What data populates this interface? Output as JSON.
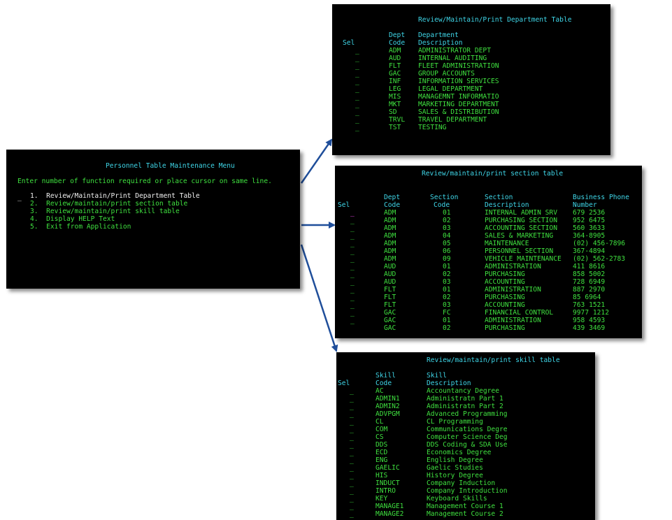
{
  "menu": {
    "title": "Personnel Table Maintenance Menu",
    "instruction": "Enter number of function required or place cursor on same line.",
    "cursor": "_",
    "items": [
      {
        "num": "1.",
        "label": "Review/Maintain/Print Department Table"
      },
      {
        "num": "2.",
        "label": "Review/maintain/print section table"
      },
      {
        "num": "3.",
        "label": "Review/maintain/print skill table"
      },
      {
        "num": "4.",
        "label": "Display HELP Text"
      },
      {
        "num": "5.",
        "label": "Exit from Application"
      }
    ]
  },
  "dept": {
    "title": "Review/Maintain/Print Department Table",
    "headers": {
      "sel": "Sel",
      "code1": "Dept",
      "code2": "Code",
      "desc1": "Department",
      "desc2": "Description"
    },
    "rows": [
      {
        "sel": "_",
        "code": "ADM",
        "desc": "ADMINISTRATOR DEPT"
      },
      {
        "sel": "_",
        "code": "AUD",
        "desc": "INTERNAL AUDITING"
      },
      {
        "sel": "_",
        "code": "FLT",
        "desc": "FLEET ADMINISTRATION"
      },
      {
        "sel": "_",
        "code": "GAC",
        "desc": "GROUP ACCOUNTS"
      },
      {
        "sel": "_",
        "code": "INF",
        "desc": "INFORMATION SERVICES"
      },
      {
        "sel": "_",
        "code": "LEG",
        "desc": "LEGAL DEPARTMENT"
      },
      {
        "sel": "_",
        "code": "MIS",
        "desc": "MANAGEMNT INFORMATIO"
      },
      {
        "sel": "_",
        "code": "MKT",
        "desc": "MARKETING DEPARTMENT"
      },
      {
        "sel": "_",
        "code": "SD",
        "desc": "SALES & DISTRIBUTION"
      },
      {
        "sel": "_",
        "code": "TRVL",
        "desc": "TRAVEL DEPARTMENT"
      },
      {
        "sel": "_",
        "code": "TST",
        "desc": "TESTING"
      }
    ]
  },
  "section": {
    "title": "Review/maintain/print section table",
    "headers": {
      "sel": "Sel",
      "dept1": "Dept",
      "dept2": "Code",
      "sec1": "Section",
      "sec2": "Code",
      "desc1": "Section",
      "desc2": "Description",
      "phone1": "Business Phone",
      "phone2": "Number"
    },
    "rows": [
      {
        "sel": "_",
        "dept": "ADM",
        "sec": "01",
        "desc": "INTERNAL ADMIN SRV",
        "phone": "679 2536"
      },
      {
        "sel": "_",
        "dept": "ADM",
        "sec": "02",
        "desc": "PURCHASING SECTION",
        "phone": "952 6475"
      },
      {
        "sel": "_",
        "dept": "ADM",
        "sec": "03",
        "desc": "ACCOUNTING SECTION",
        "phone": "560 3633"
      },
      {
        "sel": "_",
        "dept": "ADM",
        "sec": "04",
        "desc": "SALES & MARKETING",
        "phone": "364-8905"
      },
      {
        "sel": "_",
        "dept": "ADM",
        "sec": "05",
        "desc": "MAINTENANCE",
        "phone": "(02) 456-7896"
      },
      {
        "sel": "_",
        "dept": "ADM",
        "sec": "06",
        "desc": "PERSONNEL SECTION",
        "phone": "367-4894"
      },
      {
        "sel": "_",
        "dept": "ADM",
        "sec": "09",
        "desc": "VEHICLE MAINTENANCE",
        "phone": "(02) 562-2783"
      },
      {
        "sel": "_",
        "dept": "AUD",
        "sec": "01",
        "desc": "ADMINISTRATION",
        "phone": "411 8616"
      },
      {
        "sel": "_",
        "dept": "AUD",
        "sec": "02",
        "desc": "PURCHASING",
        "phone": "858 5002"
      },
      {
        "sel": "_",
        "dept": "AUD",
        "sec": "03",
        "desc": "ACCOUNTING",
        "phone": "728 6949"
      },
      {
        "sel": "_",
        "dept": "FLT",
        "sec": "01",
        "desc": "ADMINISTRATION",
        "phone": "887 2970"
      },
      {
        "sel": "_",
        "dept": "FLT",
        "sec": "02",
        "desc": "PURCHASING",
        "phone": "85 6964"
      },
      {
        "sel": "_",
        "dept": "FLT",
        "sec": "03",
        "desc": "ACCOUNTING",
        "phone": "763 1521"
      },
      {
        "sel": "_",
        "dept": "GAC",
        "sec": "FC",
        "desc": "FINANCIAL CONTROL",
        "phone": "9977 1212"
      },
      {
        "sel": "_",
        "dept": "GAC",
        "sec": "01",
        "desc": "ADMINISTRATION",
        "phone": "958 4593"
      },
      {
        "sel": "",
        "dept": "GAC",
        "sec": "02",
        "desc": "PURCHASING",
        "phone": "439 3469"
      }
    ]
  },
  "skill": {
    "title": "Review/maintain/print skill table",
    "headers": {
      "sel": "Sel",
      "code1": "Skill",
      "code2": "Code",
      "desc1": "Skill",
      "desc2": "Description"
    },
    "rows": [
      {
        "sel": "_",
        "code": "AC",
        "desc": "Accountancy Degree"
      },
      {
        "sel": "_",
        "code": "ADMIN1",
        "desc": "Administratn Part 1"
      },
      {
        "sel": "_",
        "code": "ADMIN2",
        "desc": "Administratn Part 2"
      },
      {
        "sel": "_",
        "code": "ADVPGM",
        "desc": "Advanced Programming"
      },
      {
        "sel": "_",
        "code": "CL",
        "desc": "CL Programming"
      },
      {
        "sel": "_",
        "code": "COM",
        "desc": "Communications Degre"
      },
      {
        "sel": "_",
        "code": "CS",
        "desc": "Computer Science Deg"
      },
      {
        "sel": "_",
        "code": "DDS",
        "desc": "DDS Coding & SDA Use"
      },
      {
        "sel": "_",
        "code": "ECD",
        "desc": "Economics Degree"
      },
      {
        "sel": "_",
        "code": "ENG",
        "desc": "English Degree"
      },
      {
        "sel": "_",
        "code": "GAELIC",
        "desc": "Gaelic Studies"
      },
      {
        "sel": "_",
        "code": "HIS",
        "desc": "History Degree"
      },
      {
        "sel": "_",
        "code": "INDUCT",
        "desc": "Company Induction"
      },
      {
        "sel": "_",
        "code": "INTRO",
        "desc": "Company Introduction"
      },
      {
        "sel": "_",
        "code": "KEY",
        "desc": "Keyboard Skills"
      },
      {
        "sel": "_",
        "code": "MANAGE1",
        "desc": "Management Course 1"
      },
      {
        "sel": "_",
        "code": "MANAGE2",
        "desc": "Management Course 2"
      }
    ]
  },
  "colors": {
    "background": "#000000",
    "cyan": "#3fd6e8",
    "green": "#3fe03f",
    "white": "#f2f2f2",
    "arrow": "#1f4e9a"
  }
}
